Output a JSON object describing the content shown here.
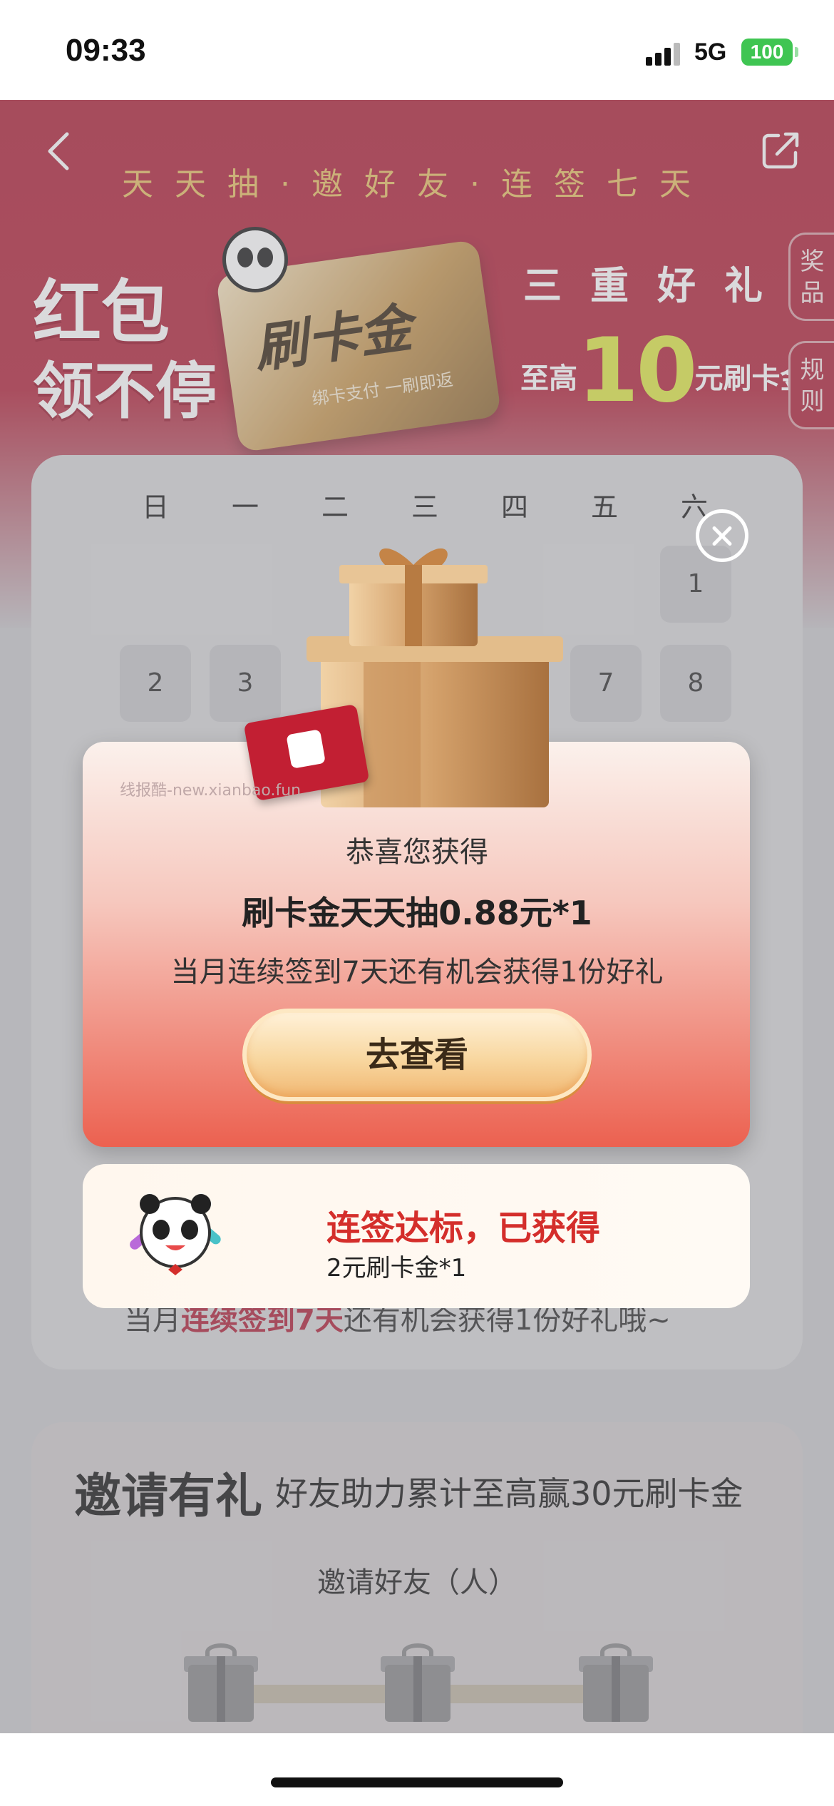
{
  "status_bar": {
    "time": "09:33",
    "network": "5G",
    "battery": "100"
  },
  "header": {
    "slogan": "天天抽·邀好友·连签七天"
  },
  "hero": {
    "headline_line1": "红包",
    "headline_line2": "领不停",
    "card_title": "刷卡金",
    "card_subtitle": "绑卡支付 一刷即返",
    "tagline": "三重好礼",
    "max_prefix": "至高",
    "max_amount": "10",
    "max_suffix": "元刷卡金"
  },
  "side_tabs": {
    "prizes": "奖品",
    "rules": "规则"
  },
  "calendar": {
    "weekdays": [
      "日",
      "一",
      "二",
      "三",
      "四",
      "五",
      "六"
    ],
    "visible_days": [
      "1",
      "2",
      "3",
      "7",
      "8"
    ],
    "footer_prefix": "当月",
    "footer_highlight": "连续签到7天",
    "footer_suffix": "还有机会获得1份好礼哦~"
  },
  "modal": {
    "watermark": "线报酷-new.xianbao.fun",
    "congrats": "恭喜您获得",
    "prize": "刷卡金天天抽0.88元*1",
    "hint": "当月连续签到7天还有机会获得1份好礼",
    "button": "去查看"
  },
  "toast": {
    "title": "连签达标，已获得",
    "subtitle": "2元刷卡金*1"
  },
  "invite": {
    "title": "邀请有礼",
    "subtitle": "好友助力累计至高赢30元刷卡金",
    "label": "邀请好友（人）"
  },
  "colors": {
    "brand_red": "#b0263c",
    "gold": "#e8c068",
    "highlight_yellow": "#dfe84a",
    "toast_red": "#d42e2b"
  }
}
